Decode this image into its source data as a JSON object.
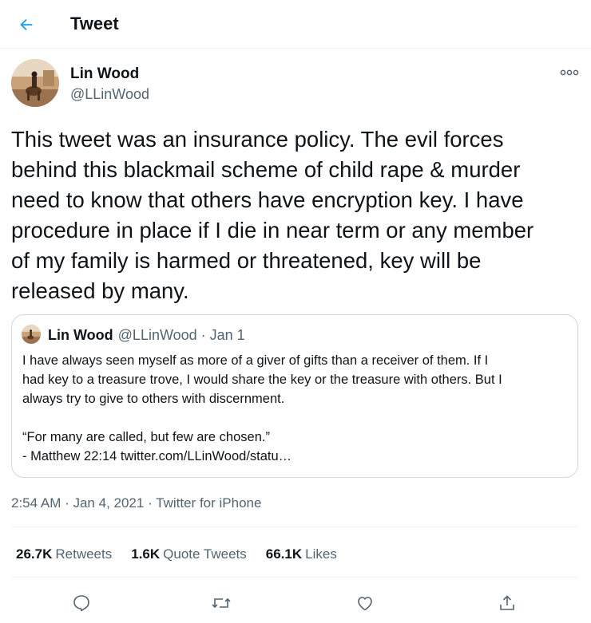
{
  "header": {
    "title": "Tweet",
    "back_icon": "arrow-left-icon"
  },
  "colors": {
    "accent": "#1d9bf0",
    "secondary_text": "#536471",
    "border": "#cfd9de"
  },
  "tweet": {
    "author_name": "Lin Wood",
    "author_handle": "@LLinWood",
    "text": "This tweet was an insurance policy. The evil forces\nbehind this blackmail scheme of child rape & murder\nneed to know that others have encryption key. I have\nprocedure in place if I die in near term or any member\nof my family is harmed or threatened, key will be\nreleased by many.",
    "timestamp": "2:54 AM · Jan 4, 2021",
    "separator": " · ",
    "source": "Twitter for iPhone"
  },
  "quote": {
    "author_name": "Lin Wood",
    "meta": "@LLinWood · Jan 1",
    "text": "I have always seen myself as more of a giver of gifts than a receiver of them. If I\nhad key to a treasure trove, I would share the key or the treasure with others. But I\nalways try to give to others with discernment.\n\n“For many are called, but few are chosen.”\n- Matthew 22:14 twitter.com/LLinWood/statu…"
  },
  "stats": {
    "retweets_count": "26.7K",
    "retweets_label": "Retweets",
    "quotes_count": "1.6K",
    "quotes_label": "Quote Tweets",
    "likes_count": "66.1K",
    "likes_label": "Likes"
  },
  "actions": [
    "reply-icon",
    "retweet-icon",
    "like-icon",
    "share-icon"
  ]
}
